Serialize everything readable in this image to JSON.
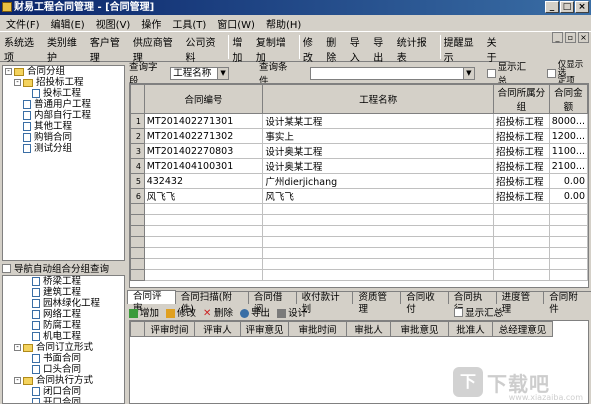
{
  "window": {
    "title": "财易工程合同管理 - [合同管理]"
  },
  "menu": [
    "文件(F)",
    "编辑(E)",
    "视图(V)",
    "操作",
    "工具(T)",
    "窗口(W)",
    "帮助(H)"
  ],
  "toolbar": [
    {
      "label": "系统选项",
      "icon": "settings-icon",
      "color": "#3a6ea5"
    },
    {
      "label": "类别维护",
      "icon": "tools-icon",
      "color": "#6b6b6b"
    },
    {
      "label": "客户管理",
      "icon": "customer-icon",
      "color": "#2e8b57"
    },
    {
      "label": "供应商管理",
      "icon": "supplier-icon",
      "color": "#d2691e"
    },
    {
      "label": "公司资料",
      "icon": "company-icon",
      "color": "#4169e1"
    },
    {
      "label": "增加",
      "icon": "add-icon",
      "color": "#e8b84a"
    },
    {
      "label": "复制增加",
      "icon": "copy-add-icon",
      "color": "#e8b84a"
    },
    {
      "label": "修改",
      "icon": "edit-icon",
      "color": "#3a8a3a"
    },
    {
      "label": "删除",
      "icon": "delete-icon",
      "color": "#cc2222"
    },
    {
      "label": "导入",
      "icon": "import-icon",
      "color": "#e8a020"
    },
    {
      "label": "导出",
      "icon": "export-icon",
      "color": "#555555"
    },
    {
      "label": "统计报表",
      "icon": "report-icon",
      "color": "#3a6ea5"
    },
    {
      "label": "提醒显示",
      "icon": "reminder-icon",
      "color": "#aa3366"
    },
    {
      "label": "关于",
      "icon": "help-icon",
      "color": "#2255aa"
    }
  ],
  "tree1": [
    {
      "label": "合同分组",
      "level": 0,
      "exp": "-",
      "type": "fold"
    },
    {
      "label": "招投标工程",
      "level": 1,
      "exp": "-",
      "type": "fold"
    },
    {
      "label": "投标工程",
      "level": 2,
      "exp": "",
      "type": "doc"
    },
    {
      "label": "普通用户工程",
      "level": 1,
      "exp": "",
      "type": "doc"
    },
    {
      "label": "内部自行工程",
      "level": 1,
      "exp": "",
      "type": "doc"
    },
    {
      "label": "其他工程",
      "level": 1,
      "exp": "",
      "type": "doc"
    },
    {
      "label": "购销合同",
      "level": 1,
      "exp": "",
      "type": "doc"
    },
    {
      "label": "测试分组",
      "level": 1,
      "exp": "",
      "type": "doc"
    }
  ],
  "left_header": "导航自动组合分组查询",
  "tree2": [
    {
      "label": "桥梁工程",
      "level": 2,
      "exp": "",
      "type": "doc"
    },
    {
      "label": "建筑工程",
      "level": 2,
      "exp": "",
      "type": "doc"
    },
    {
      "label": "园林绿化工程",
      "level": 2,
      "exp": "",
      "type": "doc"
    },
    {
      "label": "网络工程",
      "level": 2,
      "exp": "",
      "type": "doc"
    },
    {
      "label": "防腐工程",
      "level": 2,
      "exp": "",
      "type": "doc"
    },
    {
      "label": "机电工程",
      "level": 2,
      "exp": "",
      "type": "doc"
    },
    {
      "label": "合同订立形式",
      "level": 1,
      "exp": "-",
      "type": "fold"
    },
    {
      "label": "书面合同",
      "level": 2,
      "exp": "",
      "type": "doc"
    },
    {
      "label": "口头合同",
      "level": 2,
      "exp": "",
      "type": "doc"
    },
    {
      "label": "合同执行方式",
      "level": 1,
      "exp": "-",
      "type": "fold"
    },
    {
      "label": "闭口合同",
      "level": 2,
      "exp": "",
      "type": "doc"
    },
    {
      "label": "开口合同",
      "level": 2,
      "exp": "",
      "type": "doc"
    }
  ],
  "search": {
    "field_label": "查询字段",
    "field_value": "工程名称",
    "cond_label": "查询条件",
    "cond_value": "",
    "show_summary": "显示汇总",
    "show_selected": "仅显示选",
    "show_selected2": "定项"
  },
  "grid": {
    "headers": [
      "合同编号",
      "工程名称",
      "合同所属分组",
      "合同金额"
    ],
    "rows": [
      {
        "n": "1",
        "no": "MT201402271301",
        "name": "设计某某工程",
        "group": "招投标工程",
        "amount": "8000..."
      },
      {
        "n": "2",
        "no": "MT201402271302",
        "name": "事实上",
        "group": "招投标工程",
        "amount": "1200..."
      },
      {
        "n": "3",
        "no": "MT201402270803",
        "name": "设计奥某工程",
        "group": "招投标工程",
        "amount": "1100..."
      },
      {
        "n": "4",
        "no": "MT201404100301",
        "name": "设计奥某工程",
        "group": "招投标工程",
        "amount": "2100..."
      },
      {
        "n": "5",
        "no": "432432",
        "name": "广州dierjichang",
        "group": "招投标工程",
        "amount": "0.00"
      },
      {
        "n": "6",
        "no": "风飞飞",
        "name": "风飞飞",
        "group": "招投标工程",
        "amount": "0.00"
      }
    ]
  },
  "tabs": [
    "合同评审",
    "合同扫描(附件)",
    "合同借阅",
    "收付款计划",
    "资质管理",
    "合同收付",
    "合同执行",
    "进度管理",
    "合同附件"
  ],
  "subtoolbar": {
    "add": "增加",
    "edit": "修改",
    "del": "删除",
    "export": "导出",
    "design": "设计",
    "summary": "显示汇总"
  },
  "grid2": {
    "headers": [
      "评审时间",
      "评审人",
      "评审意见",
      "审批时间",
      "审批人",
      "审批意见",
      "批准人",
      "总经理意见"
    ]
  },
  "watermark": {
    "badge": "下",
    "text": "下载吧",
    "url": "www.xiazaiba.com"
  }
}
